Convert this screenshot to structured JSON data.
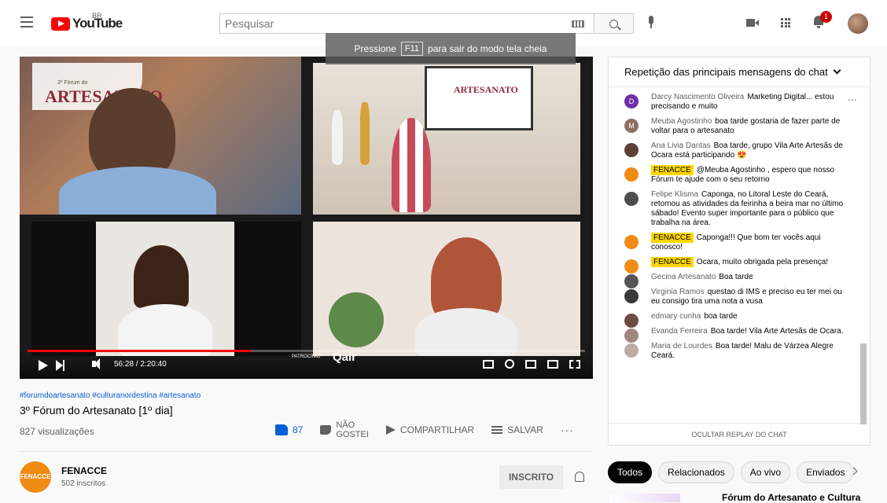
{
  "header": {
    "logo_text": "YouTube",
    "region": "BR",
    "search_placeholder": "Pesquisar",
    "notification_count": "1"
  },
  "toast": {
    "before": "Pressione",
    "key": "F11",
    "after": "para sair do modo tela cheia"
  },
  "player": {
    "forum_small": "3º Fórum do",
    "forum_title": "ARTESANATO",
    "tv_title": "ARTESANATO",
    "sponsor_label": "PATROCÍNIO",
    "sponsor_logo": "Qair",
    "time": "56:28 / 2:20:40",
    "progress_fraction": 0.401
  },
  "video": {
    "hashtags": "#forumdoartesanato #culturanordestina #artesanato",
    "title": "3º Fórum do Artesanato [1º dia]",
    "views": "827 visualizações",
    "likes": "87",
    "dislike_label_1": "NÃO",
    "dislike_label_2": "GOSTEI",
    "share_label": "COMPARTILHAR",
    "save_label": "SALVAR",
    "more": "···"
  },
  "channel": {
    "avatar_text": "FENACCE",
    "name": "FENACCE",
    "subscribers": "502 inscritos",
    "subscribe_label": "INSCRITO"
  },
  "chat": {
    "header": "Repetição das principais mensagens do chat",
    "messages": [
      {
        "author": "Darcy Nascimento Oliveira",
        "text": "Marketing Digital... estou precisando e muito",
        "avatar": "D",
        "color": "#6f2da8",
        "badge": false
      },
      {
        "author": "Meuba Agostinho",
        "text": "boa tarde gostaria de fazer parte de voltar para o artesanato",
        "avatar": "M",
        "color": "#8d6e63",
        "badge": false
      },
      {
        "author": "Ana Livia Dantas",
        "text": "Boa tarde, grupo Vila Arte Artesãs de Ocara está participando 😍",
        "avatar": "",
        "color": "#5d4037",
        "badge": false
      },
      {
        "author": "FENACCE",
        "text": "@Meuba Agostinho , espero que nosso Fórum te ajude com o seu retorno",
        "avatar": "",
        "color": "#f08b14",
        "badge": true
      },
      {
        "author": "Felipe Klisma",
        "text": "Caponga, no Litoral Leste do Ceará, retomou as atividades da feirinha a beira mar no último sábado! Evento super importante para o público que trabalha na área.",
        "avatar": "",
        "color": "#4e4e4e",
        "badge": false
      },
      {
        "author": "FENACCE",
        "text": "Caponga!!! Que bom ter vocês aqui conosco!",
        "avatar": "",
        "color": "#f08b14",
        "badge": true
      },
      {
        "author": "FENACCE",
        "text": "Ocara, muito obrigada pela presença!",
        "avatar": "",
        "color": "#f08b14",
        "badge": true
      },
      {
        "author": "Gecina Artesanato",
        "text": "Boa tarde",
        "avatar": "",
        "color": "#555555",
        "badge": false
      },
      {
        "author": "Virginia Ramos",
        "text": "questao di IMS e preciso eu ter mei ou eu consigo tira uma nota a vusa",
        "avatar": "",
        "color": "#3a3a3a",
        "badge": false
      },
      {
        "author": "edmary cunha",
        "text": "boa tarde",
        "avatar": "",
        "color": "#6d4c41",
        "badge": false
      },
      {
        "author": "Evanda Ferreira",
        "text": "Boa tarde! Vila Arte Artesãs de Ocara.",
        "avatar": "",
        "color": "#a1887f",
        "badge": false
      },
      {
        "author": "Maria de Lourdes",
        "text": "Boa tarde! Malu de Várzea Alegre Ceará.",
        "avatar": "",
        "color": "#bcaaa4",
        "badge": false
      }
    ],
    "hide_replay": "OCULTAR REPLAY DO CHAT"
  },
  "chips": [
    "Todos",
    "Relacionados",
    "Ao vivo",
    "Enviados"
  ],
  "related": {
    "title": "Fórum do Artesanato e Cultura"
  }
}
